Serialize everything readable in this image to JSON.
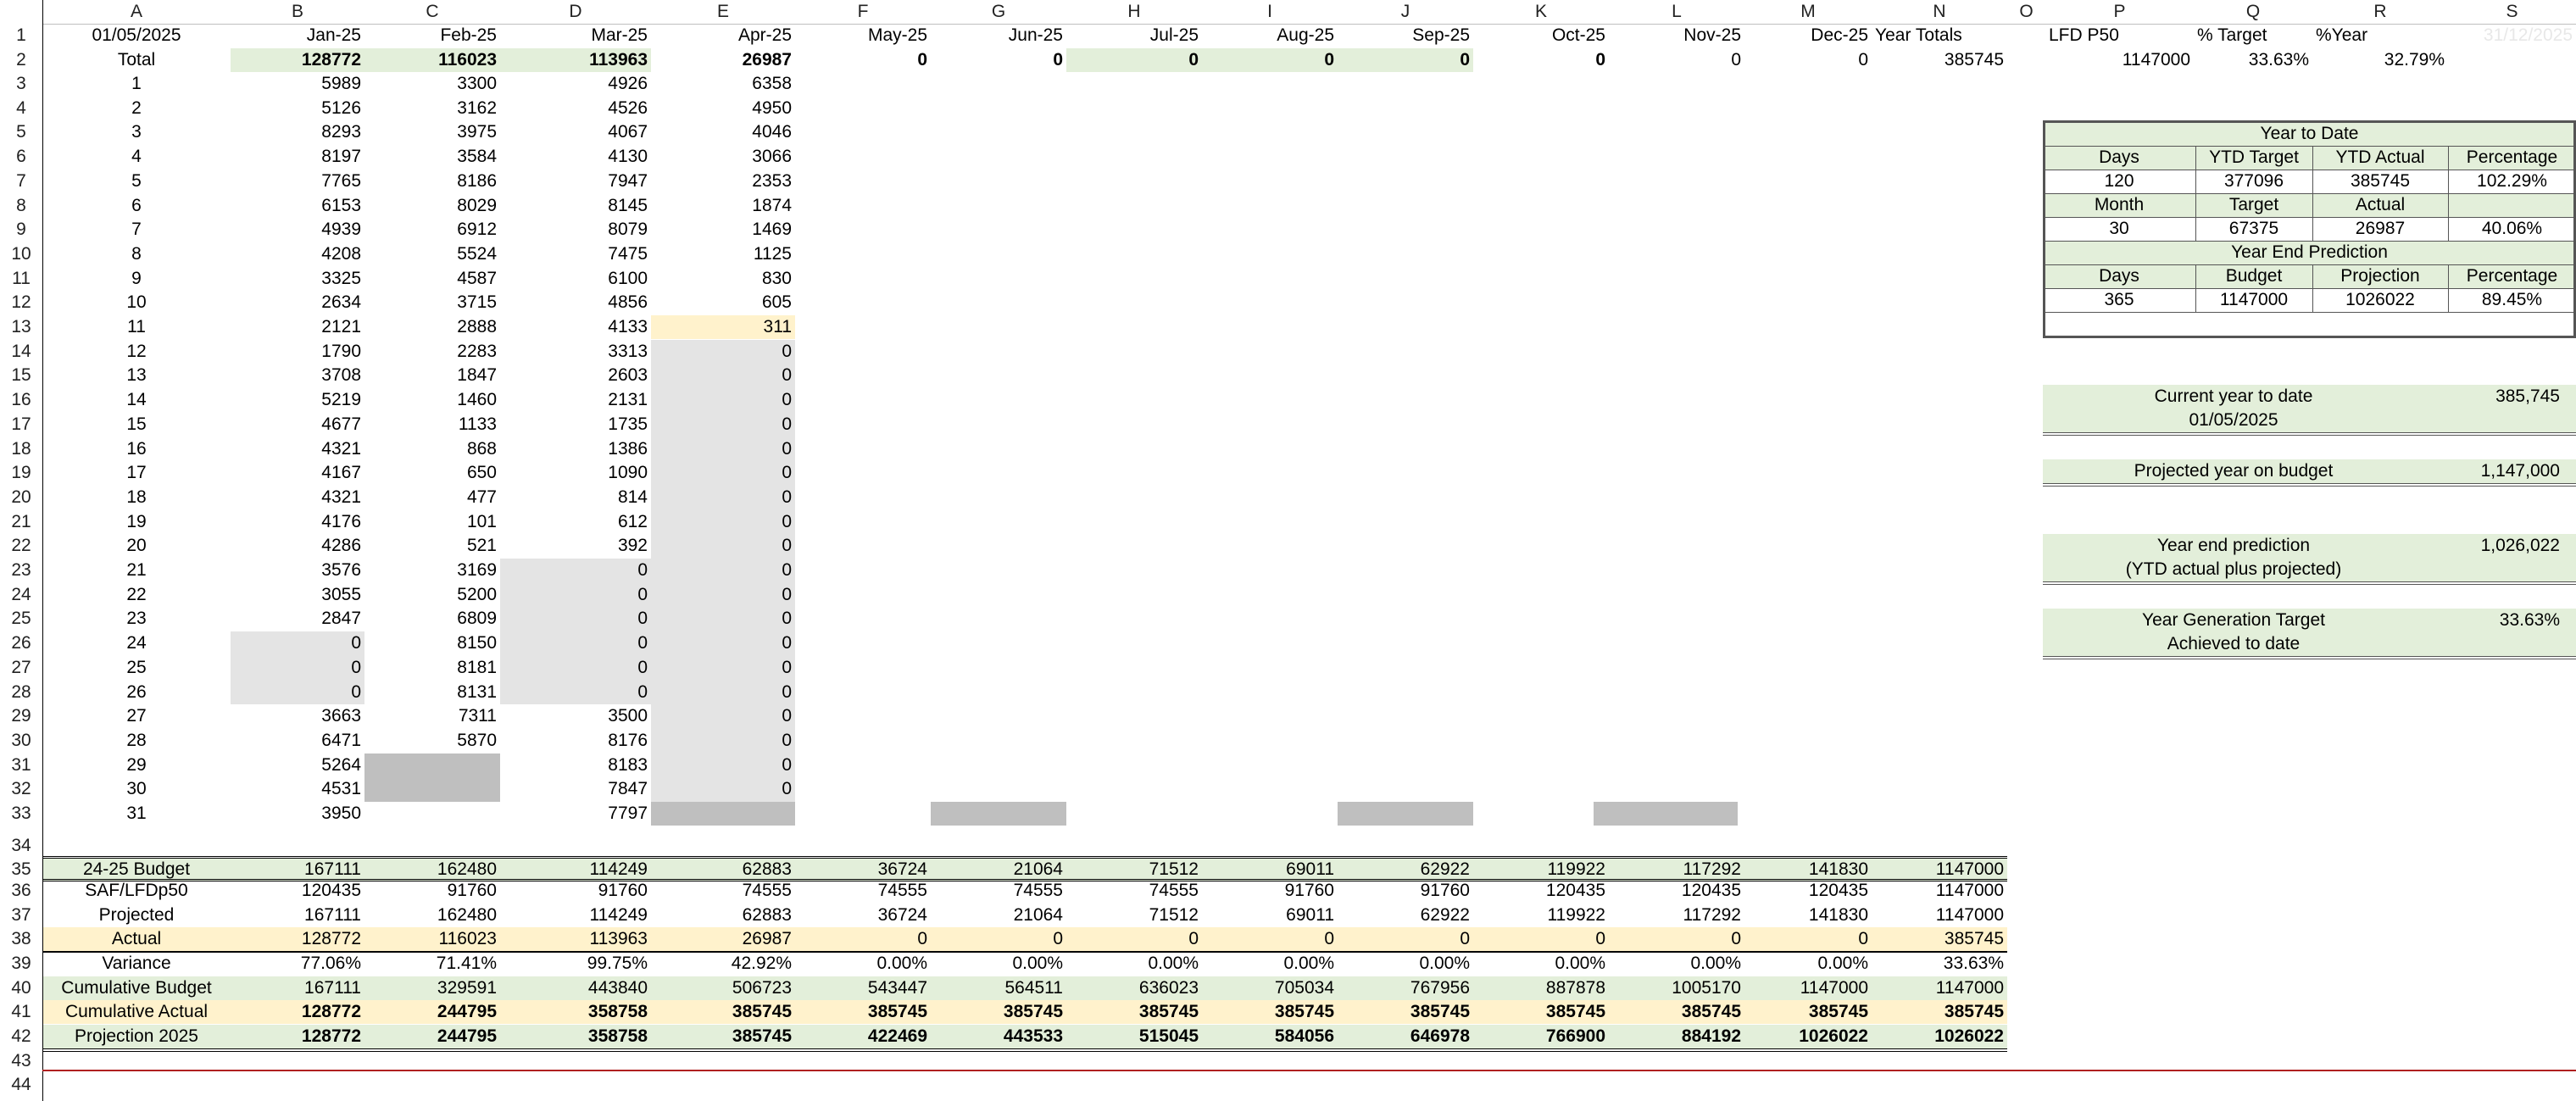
{
  "columns": [
    "A",
    "B",
    "C",
    "D",
    "E",
    "F",
    "G",
    "H",
    "I",
    "J",
    "K",
    "L",
    "M",
    "N",
    "O",
    "P",
    "Q",
    "R",
    "S"
  ],
  "row_numbers": [
    1,
    2,
    3,
    4,
    5,
    6,
    7,
    8,
    9,
    10,
    11,
    12,
    13,
    14,
    15,
    16,
    17,
    18,
    19,
    20,
    21,
    22,
    23,
    24,
    25,
    26,
    27,
    28,
    29,
    30,
    31,
    32,
    33,
    34,
    35,
    36,
    37,
    38,
    39,
    40,
    41,
    42,
    43,
    44
  ],
  "header_row": {
    "date": "01/05/2025",
    "months": [
      "Jan-25",
      "Feb-25",
      "Mar-25",
      "Apr-25",
      "May-25",
      "Jun-25",
      "Jul-25",
      "Aug-25",
      "Sep-25",
      "Oct-25",
      "Nov-25",
      "Dec-25"
    ],
    "year_totals": "Year Totals",
    "lfd_p50": "LFD P50",
    "pct_target": "% Target",
    "pct_year": "%Year",
    "end_date": "31/12/2025"
  },
  "total_row": {
    "label": "Total",
    "values": [
      "128772",
      "116023",
      "113963",
      "26987",
      "0",
      "0",
      "0",
      "0",
      "0",
      "0",
      "0",
      "0"
    ],
    "year_total": "385745",
    "lfd_p50": "1147000",
    "pct_target": "33.63%",
    "pct_year": "32.79%"
  },
  "days": [
    {
      "d": "1",
      "v": [
        "5989",
        "3300",
        "4926",
        "6358"
      ]
    },
    {
      "d": "2",
      "v": [
        "5126",
        "3162",
        "4526",
        "4950"
      ]
    },
    {
      "d": "3",
      "v": [
        "8293",
        "3975",
        "4067",
        "4046"
      ]
    },
    {
      "d": "4",
      "v": [
        "8197",
        "3584",
        "4130",
        "3066"
      ]
    },
    {
      "d": "5",
      "v": [
        "7765",
        "8186",
        "7947",
        "2353"
      ]
    },
    {
      "d": "6",
      "v": [
        "6153",
        "8029",
        "8145",
        "1874"
      ]
    },
    {
      "d": "7",
      "v": [
        "4939",
        "6912",
        "8079",
        "1469"
      ]
    },
    {
      "d": "8",
      "v": [
        "4208",
        "5524",
        "7475",
        "1125"
      ]
    },
    {
      "d": "9",
      "v": [
        "3325",
        "4587",
        "6100",
        "830"
      ]
    },
    {
      "d": "10",
      "v": [
        "2634",
        "3715",
        "4856",
        "605"
      ]
    },
    {
      "d": "11",
      "v": [
        "2121",
        "2888",
        "4133",
        "311"
      ]
    },
    {
      "d": "12",
      "v": [
        "1790",
        "2283",
        "3313",
        "0"
      ]
    },
    {
      "d": "13",
      "v": [
        "3708",
        "1847",
        "2603",
        "0"
      ]
    },
    {
      "d": "14",
      "v": [
        "5219",
        "1460",
        "2131",
        "0"
      ]
    },
    {
      "d": "15",
      "v": [
        "4677",
        "1133",
        "1735",
        "0"
      ]
    },
    {
      "d": "16",
      "v": [
        "4321",
        "868",
        "1386",
        "0"
      ]
    },
    {
      "d": "17",
      "v": [
        "4167",
        "650",
        "1090",
        "0"
      ]
    },
    {
      "d": "18",
      "v": [
        "4321",
        "477",
        "814",
        "0"
      ]
    },
    {
      "d": "19",
      "v": [
        "4176",
        "101",
        "612",
        "0"
      ]
    },
    {
      "d": "20",
      "v": [
        "4286",
        "521",
        "392",
        "0"
      ]
    },
    {
      "d": "21",
      "v": [
        "3576",
        "3169",
        "0",
        "0"
      ]
    },
    {
      "d": "22",
      "v": [
        "3055",
        "5200",
        "0",
        "0"
      ]
    },
    {
      "d": "23",
      "v": [
        "2847",
        "6809",
        "0",
        "0"
      ]
    },
    {
      "d": "24",
      "v": [
        "0",
        "8150",
        "0",
        "0"
      ]
    },
    {
      "d": "25",
      "v": [
        "0",
        "8181",
        "0",
        "0"
      ]
    },
    {
      "d": "26",
      "v": [
        "0",
        "8131",
        "0",
        "0"
      ]
    },
    {
      "d": "27",
      "v": [
        "3663",
        "7311",
        "3500",
        "0"
      ]
    },
    {
      "d": "28",
      "v": [
        "6471",
        "5870",
        "8176",
        "0"
      ]
    },
    {
      "d": "29",
      "v": [
        "5264",
        "",
        "8183",
        "0"
      ]
    },
    {
      "d": "30",
      "v": [
        "4531",
        "",
        "7847",
        "0"
      ]
    },
    {
      "d": "31",
      "v": [
        "3950",
        "",
        "7797",
        ""
      ]
    }
  ],
  "summary_rows": [
    {
      "label": "24-25 Budget",
      "values": [
        "167111",
        "162480",
        "114249",
        "62883",
        "36724",
        "21064",
        "71512",
        "69011",
        "62922",
        "119922",
        "117292",
        "141830",
        "1147000"
      ]
    },
    {
      "label": "SAF/LFDp50",
      "values": [
        "120435",
        "91760",
        "91760",
        "74555",
        "74555",
        "74555",
        "74555",
        "91760",
        "91760",
        "120435",
        "120435",
        "120435",
        "1147000"
      ]
    },
    {
      "label": "Projected",
      "values": [
        "167111",
        "162480",
        "114249",
        "62883",
        "36724",
        "21064",
        "71512",
        "69011",
        "62922",
        "119922",
        "117292",
        "141830",
        "1147000"
      ]
    },
    {
      "label": "Actual",
      "values": [
        "128772",
        "116023",
        "113963",
        "26987",
        "0",
        "0",
        "0",
        "0",
        "0",
        "0",
        "0",
        "0",
        "385745"
      ]
    },
    {
      "label": "Variance",
      "values": [
        "77.06%",
        "71.41%",
        "99.75%",
        "42.92%",
        "0.00%",
        "0.00%",
        "0.00%",
        "0.00%",
        "0.00%",
        "0.00%",
        "0.00%",
        "0.00%",
        "33.63%"
      ]
    },
    {
      "label": "Cumulative Budget",
      "values": [
        "167111",
        "329591",
        "443840",
        "506723",
        "543447",
        "564511",
        "636023",
        "705034",
        "767956",
        "887878",
        "1005170",
        "1147000",
        "1147000"
      ]
    },
    {
      "label": "Cumulative Actual",
      "values": [
        "128772",
        "244795",
        "358758",
        "385745",
        "385745",
        "385745",
        "385745",
        "385745",
        "385745",
        "385745",
        "385745",
        "385745",
        "385745"
      ]
    },
    {
      "label": "Projection 2025",
      "values": [
        "128772",
        "244795",
        "358758",
        "385745",
        "422469",
        "443533",
        "515045",
        "584056",
        "646978",
        "766900",
        "884192",
        "1026022",
        "1026022"
      ]
    }
  ],
  "ytd_panel": {
    "title": "Year to Date",
    "h1": [
      "Days",
      "YTD Target",
      "YTD Actual",
      "Percentage"
    ],
    "r1": [
      "120",
      "377096",
      "385745",
      "102.29%"
    ],
    "h2": [
      "Month",
      "Target",
      "Actual"
    ],
    "r2": [
      "30",
      "67375",
      "26987",
      "40.06%"
    ],
    "subtitle": "Year End Prediction",
    "h3": [
      "Days",
      "Budget",
      "Projection",
      "Percentage"
    ],
    "r3": [
      "365",
      "1147000",
      "1026022",
      "89.45%"
    ]
  },
  "info_boxes": [
    {
      "line1": "Current year to date",
      "line2": "01/05/2025",
      "value": "385,745"
    },
    {
      "line1": "Projected year on budget",
      "line2": "",
      "value": "1,147,000"
    },
    {
      "line1": "Year end prediction",
      "line2": "(YTD actual plus projected)",
      "value": "1,026,022"
    },
    {
      "line1": "Year Generation Target",
      "line2": "Achieved to date",
      "value": "33.63%"
    }
  ]
}
